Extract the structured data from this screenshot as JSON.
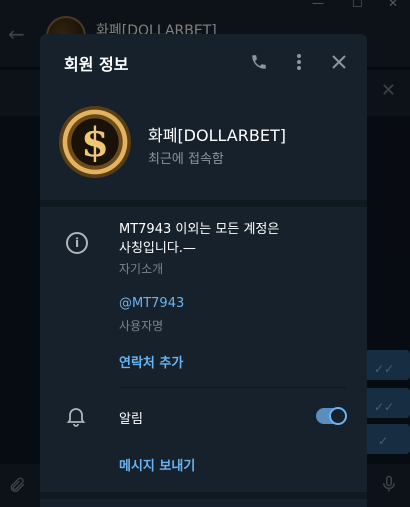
{
  "background": {
    "chat_title": "화폐[DOLLARBET]",
    "window_controls": [
      "—",
      "☐",
      "✕"
    ]
  },
  "dialog": {
    "title": "회원 정보",
    "profile": {
      "name": "화폐[DOLLARBET]",
      "status": "최근에 접속함",
      "avatar_symbol": "$"
    },
    "bio": {
      "line1": "MT7943 이외는 모든 계정은",
      "line2": "사칭입니다.—",
      "label": "자기소개"
    },
    "username": {
      "value": "@MT7943",
      "label": "사용자명"
    },
    "add_contact_label": "연락처 추가",
    "notifications": {
      "label": "알림",
      "enabled": true
    },
    "send_message_label": "메시지 보내기"
  },
  "colors": {
    "accent": "#6ab3f3",
    "panel": "#17212b",
    "background": "#0e1621"
  }
}
